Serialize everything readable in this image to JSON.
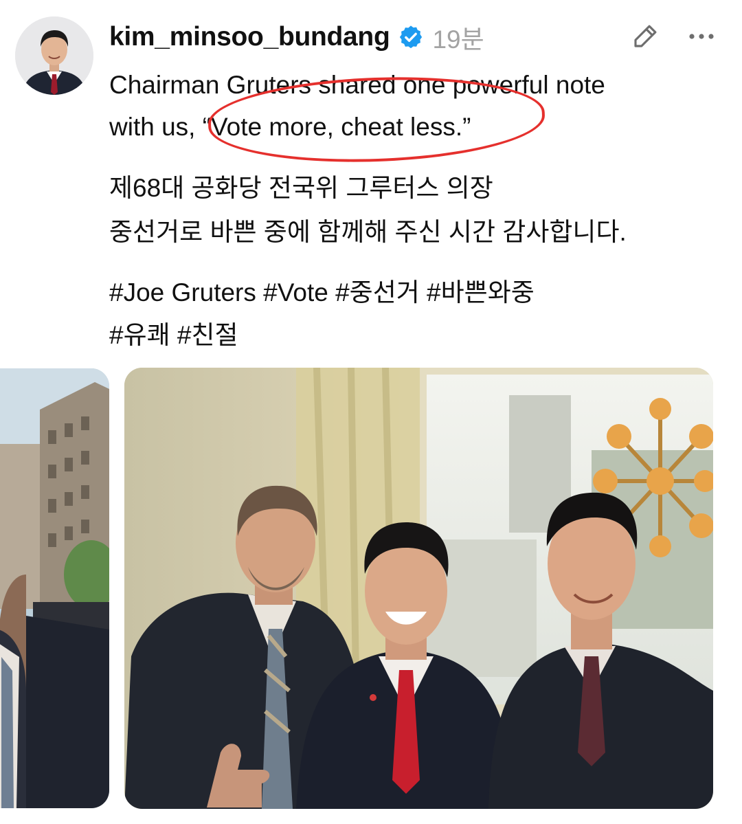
{
  "post": {
    "username": "kim_minsoo_bundang",
    "verified_icon": "verified-badge-icon",
    "timestamp": "19분",
    "caption_line1": "Chairman Gruters shared one powerful note",
    "caption_line2": "with us, “Vote more, cheat less.”",
    "korean_line1": "제68대 공화당 전국위 그루터스 의장",
    "korean_line2": "중선거로 바쁜 중에 함께해 주신 시간 감사합니다.",
    "hashtags_line1": "#Joe Gruters #Vote #중선거 #바쁜와중",
    "hashtags_line2": "#유쾌 #친절"
  },
  "toolbar": {
    "edit_icon": "pencil-icon",
    "more_icon": "more-options-icon"
  },
  "annotation": {
    "color": "#e5302d"
  },
  "colors": {
    "verified": "#1d9bf0",
    "timestamp": "#a3a3a3",
    "text": "#111111"
  }
}
